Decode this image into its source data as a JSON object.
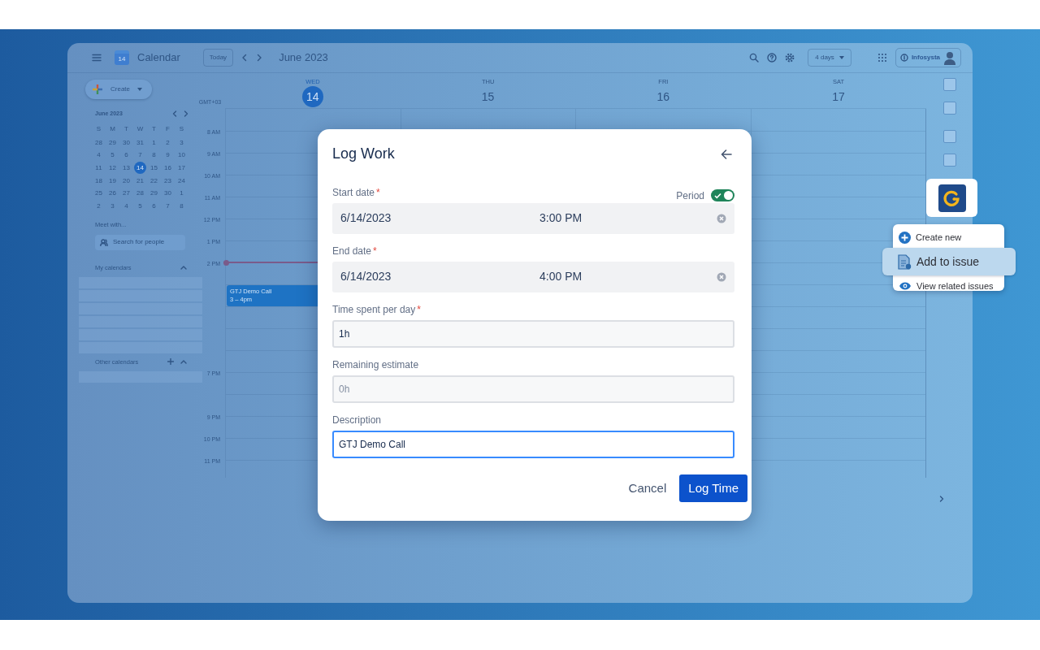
{
  "calendar": {
    "logo_text": "14",
    "app_name": "Calendar",
    "today_button": "Today",
    "period": "June 2023",
    "view_select": "4 days",
    "account": "Infosysta",
    "create_button": "Create",
    "mini_calendar": {
      "title": "June 2023",
      "weekdays": [
        "S",
        "M",
        "T",
        "W",
        "T",
        "F",
        "S"
      ],
      "weeks": [
        [
          {
            "day": "28",
            "selected": false
          },
          {
            "day": "29",
            "selected": false
          },
          {
            "day": "30",
            "selected": false
          },
          {
            "day": "31",
            "selected": false
          },
          {
            "day": "1",
            "selected": false
          },
          {
            "day": "2",
            "selected": false
          },
          {
            "day": "3",
            "selected": false
          }
        ],
        [
          {
            "day": "4",
            "selected": false
          },
          {
            "day": "5",
            "selected": false
          },
          {
            "day": "6",
            "selected": false
          },
          {
            "day": "7",
            "selected": false
          },
          {
            "day": "8",
            "selected": false
          },
          {
            "day": "9",
            "selected": false
          },
          {
            "day": "10",
            "selected": false
          }
        ],
        [
          {
            "day": "11",
            "selected": false
          },
          {
            "day": "12",
            "selected": false
          },
          {
            "day": "13",
            "selected": false
          },
          {
            "day": "14",
            "selected": true
          },
          {
            "day": "15",
            "selected": false
          },
          {
            "day": "16",
            "selected": false
          },
          {
            "day": "17",
            "selected": false
          }
        ],
        [
          {
            "day": "18",
            "selected": false
          },
          {
            "day": "19",
            "selected": false
          },
          {
            "day": "20",
            "selected": false
          },
          {
            "day": "21",
            "selected": false
          },
          {
            "day": "22",
            "selected": false
          },
          {
            "day": "23",
            "selected": false
          },
          {
            "day": "24",
            "selected": false
          }
        ],
        [
          {
            "day": "25",
            "selected": false
          },
          {
            "day": "26",
            "selected": false
          },
          {
            "day": "27",
            "selected": false
          },
          {
            "day": "28",
            "selected": false
          },
          {
            "day": "29",
            "selected": false
          },
          {
            "day": "30",
            "selected": false
          },
          {
            "day": "1",
            "selected": false
          }
        ],
        [
          {
            "day": "2",
            "selected": false
          },
          {
            "day": "3",
            "selected": false
          },
          {
            "day": "4",
            "selected": false
          },
          {
            "day": "5",
            "selected": false
          },
          {
            "day": "6",
            "selected": false
          },
          {
            "day": "7",
            "selected": false
          },
          {
            "day": "8",
            "selected": false
          }
        ]
      ]
    },
    "meet_with": {
      "title": "Meet with...",
      "placeholder": "Search for people"
    },
    "my_calendars": {
      "title": "My calendars",
      "expanded": true
    },
    "other_calendars": {
      "title": "Other calendars",
      "expanded": true
    },
    "timezone": "GMT+03",
    "days": [
      {
        "weekday": "WED",
        "date": "14",
        "today": true
      },
      {
        "weekday": "THU",
        "date": "15",
        "today": false
      },
      {
        "weekday": "FRI",
        "date": "16",
        "today": false
      },
      {
        "weekday": "SAT",
        "date": "17",
        "today": false
      }
    ],
    "hours": [
      {
        "label": "8 AM",
        "now": false
      },
      {
        "label": "9 AM",
        "now": false
      },
      {
        "label": "10 AM",
        "now": false
      },
      {
        "label": "11 AM",
        "now": false
      },
      {
        "label": "12 PM",
        "now": false
      },
      {
        "label": "1 PM",
        "now": false
      },
      {
        "label": "2 PM",
        "now": true
      },
      {
        "now": false,
        "events": [
          {
            "title": "GTJ Demo Call",
            "time": "3 – 4pm"
          }
        ]
      },
      {
        "now": false
      },
      {
        "now": false
      },
      {
        "now": false
      },
      {
        "label": "7 PM",
        "now": false
      },
      {
        "now": false
      },
      {
        "label": "9 PM",
        "now": false
      },
      {
        "label": "10 PM",
        "now": false
      },
      {
        "label": "11 PM",
        "now": false
      }
    ]
  },
  "dialog": {
    "title": "Log Work",
    "fields": [
      {
        "kind": "datetime",
        "label": "Start date",
        "required_mark": "*",
        "date": "6/14/2023",
        "time": "3:00 PM",
        "toggle": {
          "label": "Period",
          "on": true
        }
      },
      {
        "kind": "datetime",
        "label": "End date",
        "required_mark": "*",
        "date": "6/14/2023",
        "time": "4:00 PM"
      },
      {
        "kind": "text",
        "label": "Time spent per day",
        "required_mark": "*",
        "value": "1h",
        "focused": false
      },
      {
        "kind": "text",
        "label": "Remaining estimate",
        "placeholder": "0h",
        "focused": false
      },
      {
        "kind": "text",
        "label": "Description",
        "value": "GTJ Demo Call",
        "focused": true
      }
    ],
    "buttons": [
      {
        "label": "Cancel",
        "kind": "secondary"
      },
      {
        "label": "Log Time",
        "kind": "primary"
      }
    ]
  },
  "addon_menu": {
    "items": [
      {
        "label": "Create new",
        "kind": "create",
        "selected": false
      },
      {
        "label": "Add to issue",
        "kind": "add",
        "selected": true
      },
      {
        "label": "View related issues",
        "kind": "view",
        "selected": false
      }
    ]
  }
}
